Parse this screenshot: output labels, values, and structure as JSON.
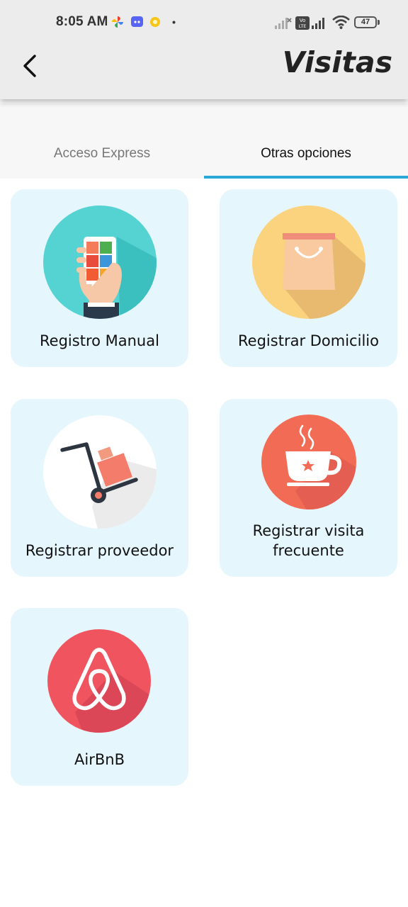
{
  "status_bar": {
    "time": "8:05 AM",
    "battery": "47",
    "icons": [
      "pinwheel-icon",
      "discord-icon",
      "coin-icon",
      "dot-icon",
      "signal-x-icon",
      "volte-icon",
      "signal-icon",
      "wifi-icon",
      "battery-icon"
    ]
  },
  "header": {
    "title": "Visitas",
    "back_icon": "chevron-left-icon"
  },
  "tabs": [
    {
      "label": "Acceso Express",
      "active": false
    },
    {
      "label": "Otras opciones",
      "active": true
    }
  ],
  "accent_color": "#2aa8d8",
  "cards": [
    {
      "label": "Registro Manual",
      "icon": "phone-hand-icon"
    },
    {
      "label": "Registrar Domicilio",
      "icon": "shopping-bag-icon"
    },
    {
      "label": "Registrar proveedor",
      "icon": "hand-truck-icon"
    },
    {
      "label_line1": "Registrar visita",
      "label_line2": "frecuente",
      "icon": "coffee-cup-icon"
    },
    {
      "label": "AirBnB",
      "icon": "airbnb-icon"
    }
  ]
}
